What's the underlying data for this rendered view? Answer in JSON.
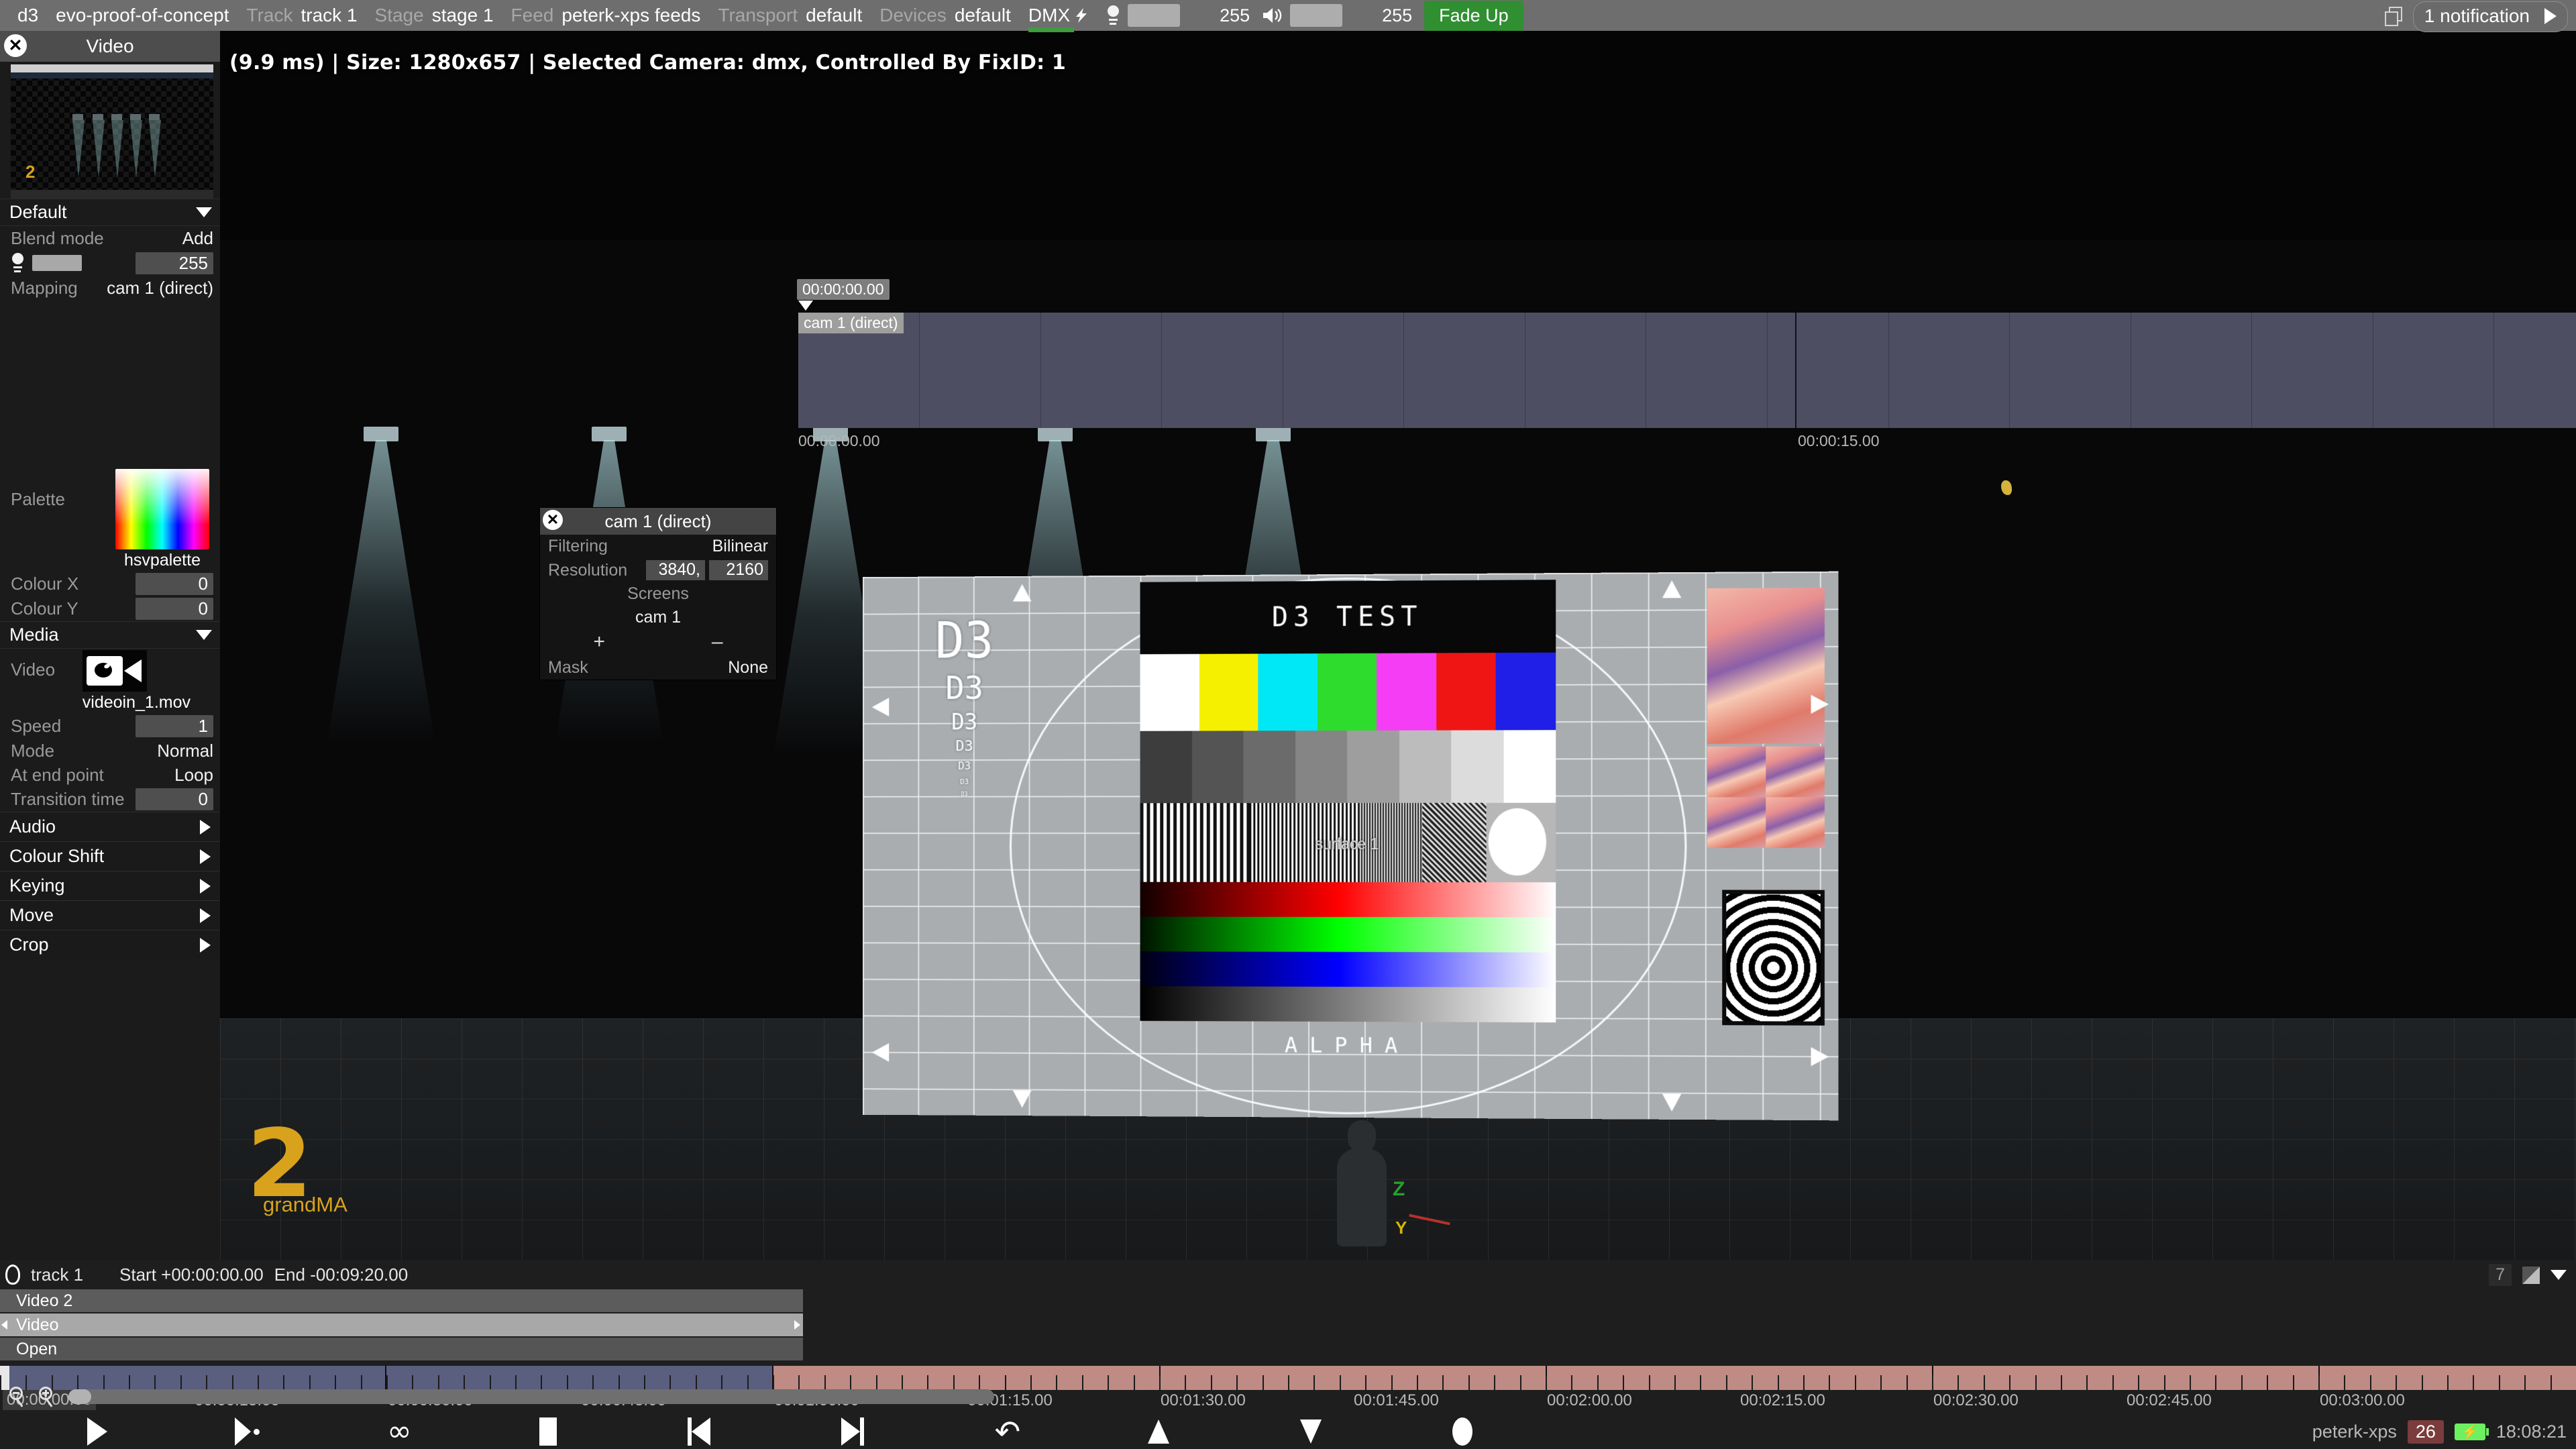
{
  "topbar": {
    "app": "d3",
    "project": "evo-proof-of-concept",
    "track_label": "Track",
    "track_value": "track 1",
    "stage_label": "Stage",
    "stage_value": "stage 1",
    "feed_label": "Feed",
    "feed_value": "peterk-xps feeds",
    "transport_label": "Transport",
    "transport_value": "default",
    "devices_label": "Devices",
    "devices_value": "default",
    "dmx_label": "DMX",
    "brightness_value": "255",
    "volume_value": "255",
    "fade_button": "Fade Up",
    "notification_text": "1 notification",
    "accent_green": "#2f8f31",
    "dmx_underline": "#3f9c3f"
  },
  "left_panel": {
    "title": "Video",
    "preset": "Default",
    "blend_mode_label": "Blend mode",
    "blend_mode_value": "Add",
    "brightness_value": "255",
    "mapping_label": "Mapping",
    "mapping_value": "cam 1 (direct)",
    "palette_label": "Palette",
    "palette_name": "hsvpalette",
    "colour_x_label": "Colour X",
    "colour_x_value": "0",
    "colour_y_label": "Colour Y",
    "colour_y_value": "0",
    "media_header": "Media",
    "video_label": "Video",
    "video_file": "videoin_1.mov",
    "speed_label": "Speed",
    "speed_value": "1",
    "mode_label": "Mode",
    "mode_value": "Normal",
    "at_end_label": "At end point",
    "at_end_value": "Loop",
    "transition_label": "Transition time",
    "transition_value": "0",
    "sections": [
      "Audio",
      "Colour Shift",
      "Keying",
      "Move",
      "Crop"
    ]
  },
  "viewport": {
    "status": "(9.9 ms) | Size: 1280x657 | Selected Camera:  dmx, Controlled By FixID: 1",
    "logo_number": "2",
    "logo_text": "grandMA",
    "axis_z": "Z",
    "axis_y": "Y",
    "screen_surface_label": "surface 1",
    "testcard": {
      "title": "D3 TEST",
      "alpha": "ALPHA",
      "d3_stack": [
        "D3",
        "D3",
        "D3",
        "D3",
        "D3",
        "D3",
        "D3"
      ],
      "color_bars": [
        "#ffffff",
        "#f5f000",
        "#00e8f5",
        "#2ddc2d",
        "#f53df5",
        "#f01515",
        "#1f1fe8"
      ],
      "gray_steps": [
        "#3d3d3d",
        "#545454",
        "#6b6b6b",
        "#858585",
        "#9e9e9e",
        "#bcbcbc",
        "#dcdcdc",
        "#ffffff"
      ]
    }
  },
  "timeline_top": {
    "cursor_time": "00:00:00.00",
    "layer_name": "cam 1 (direct)",
    "start_time": "00:00:00.00",
    "mark_time": "00:00:15.00",
    "layer_color": "#4e4e63"
  },
  "cam_panel": {
    "title": "cam 1 (direct)",
    "filtering_label": "Filtering",
    "filtering_value": "Bilinear",
    "resolution_label": "Resolution",
    "resolution_w": "3840,",
    "resolution_h": "2160",
    "screens_label": "Screens",
    "screen_item": "cam 1",
    "plus": "+",
    "minus": "–",
    "mask_label": "Mask",
    "mask_value": "None"
  },
  "bottom": {
    "track_name": "track 1",
    "start_text": "Start +00:00:00.00",
    "end_text": "End -00:09:20.00",
    "layer_count": "7",
    "bars": [
      "Video 2",
      "Video",
      "Open"
    ],
    "ruler_labels": [
      "00:00:00.00",
      "00:00:15.00",
      "00:00:30.00",
      "00:00:45.00",
      "00:01:00.00",
      "00:01:15.00",
      "00:01:30.00",
      "00:01:45.00",
      "00:02:00.00",
      "00:02:15.00",
      "00:02:30.00",
      "00:02:45.00",
      "00:03:00.00"
    ],
    "ruler_blue": "#5a5f80",
    "ruler_red": "#bf8b85",
    "transport_buttons": [
      "play-button",
      "play-section-button",
      "loop-button",
      "stop-button",
      "previous-button",
      "next-button",
      "undo-button",
      "up-button",
      "down-button",
      "record-button"
    ]
  },
  "tray": {
    "hostname": "peterk-xps",
    "badge": "26",
    "clock": "18:08:21",
    "badge_color": "#7a3c3c",
    "battery_color": "#6ef060"
  }
}
